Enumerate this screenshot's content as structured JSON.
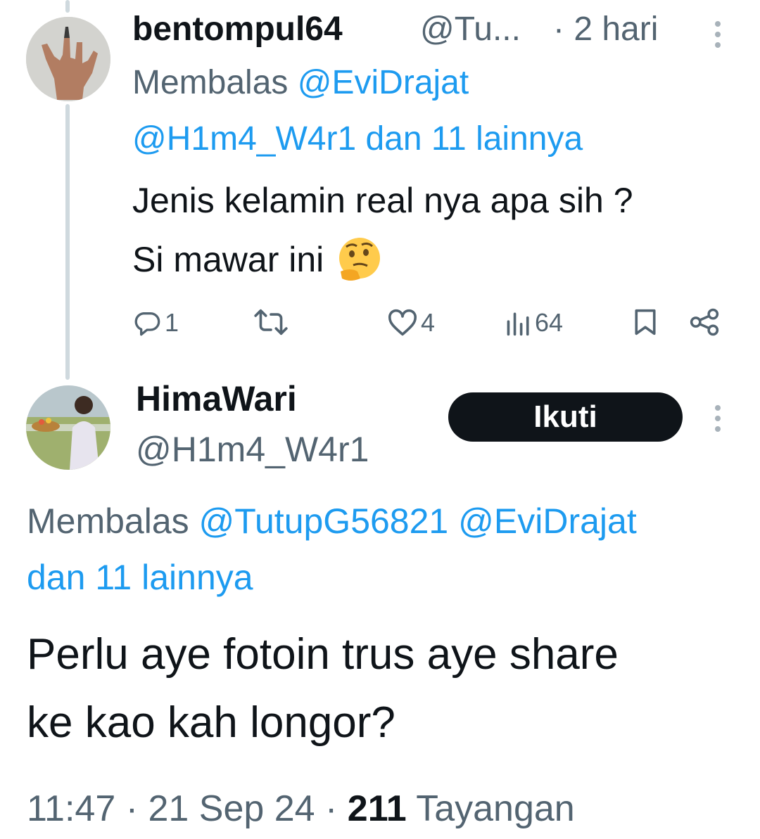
{
  "tweet1": {
    "display_name": "bentompul64",
    "handle": "@Tu...",
    "time": "· 2 hari",
    "reply_prefix": "Membalas",
    "reply_mention1": "@EviDrajat",
    "reply_mention2": "@H1m4_W4r1 dan 11 lainnya",
    "text_line1": "Jenis kelamin real nya apa sih ?",
    "text_line2": "Si mawar ini",
    "emoji": "thinking-face",
    "actions": {
      "reply_count": "1",
      "retweet_count": "",
      "like_count": "4",
      "views_count": "64"
    }
  },
  "tweet2": {
    "display_name": "HimaWari",
    "handle": "@H1m4_W4r1",
    "follow_label": "Ikuti",
    "reply_prefix": "Membalas",
    "reply_mentions": "@TutupG56821 @EviDrajat",
    "reply_more": "dan 11 lainnya",
    "text_line1": "Perlu aye fotoin trus aye share",
    "text_line2": "ke kao kah longor?",
    "meta_time": "11:47 · 21 Sep 24 · ",
    "views_count": "211",
    "views_label": " Tayangan"
  },
  "colors": {
    "accent": "#1d9bf0",
    "text": "#0f1419",
    "secondary": "#536471",
    "button": "#0f1419"
  }
}
